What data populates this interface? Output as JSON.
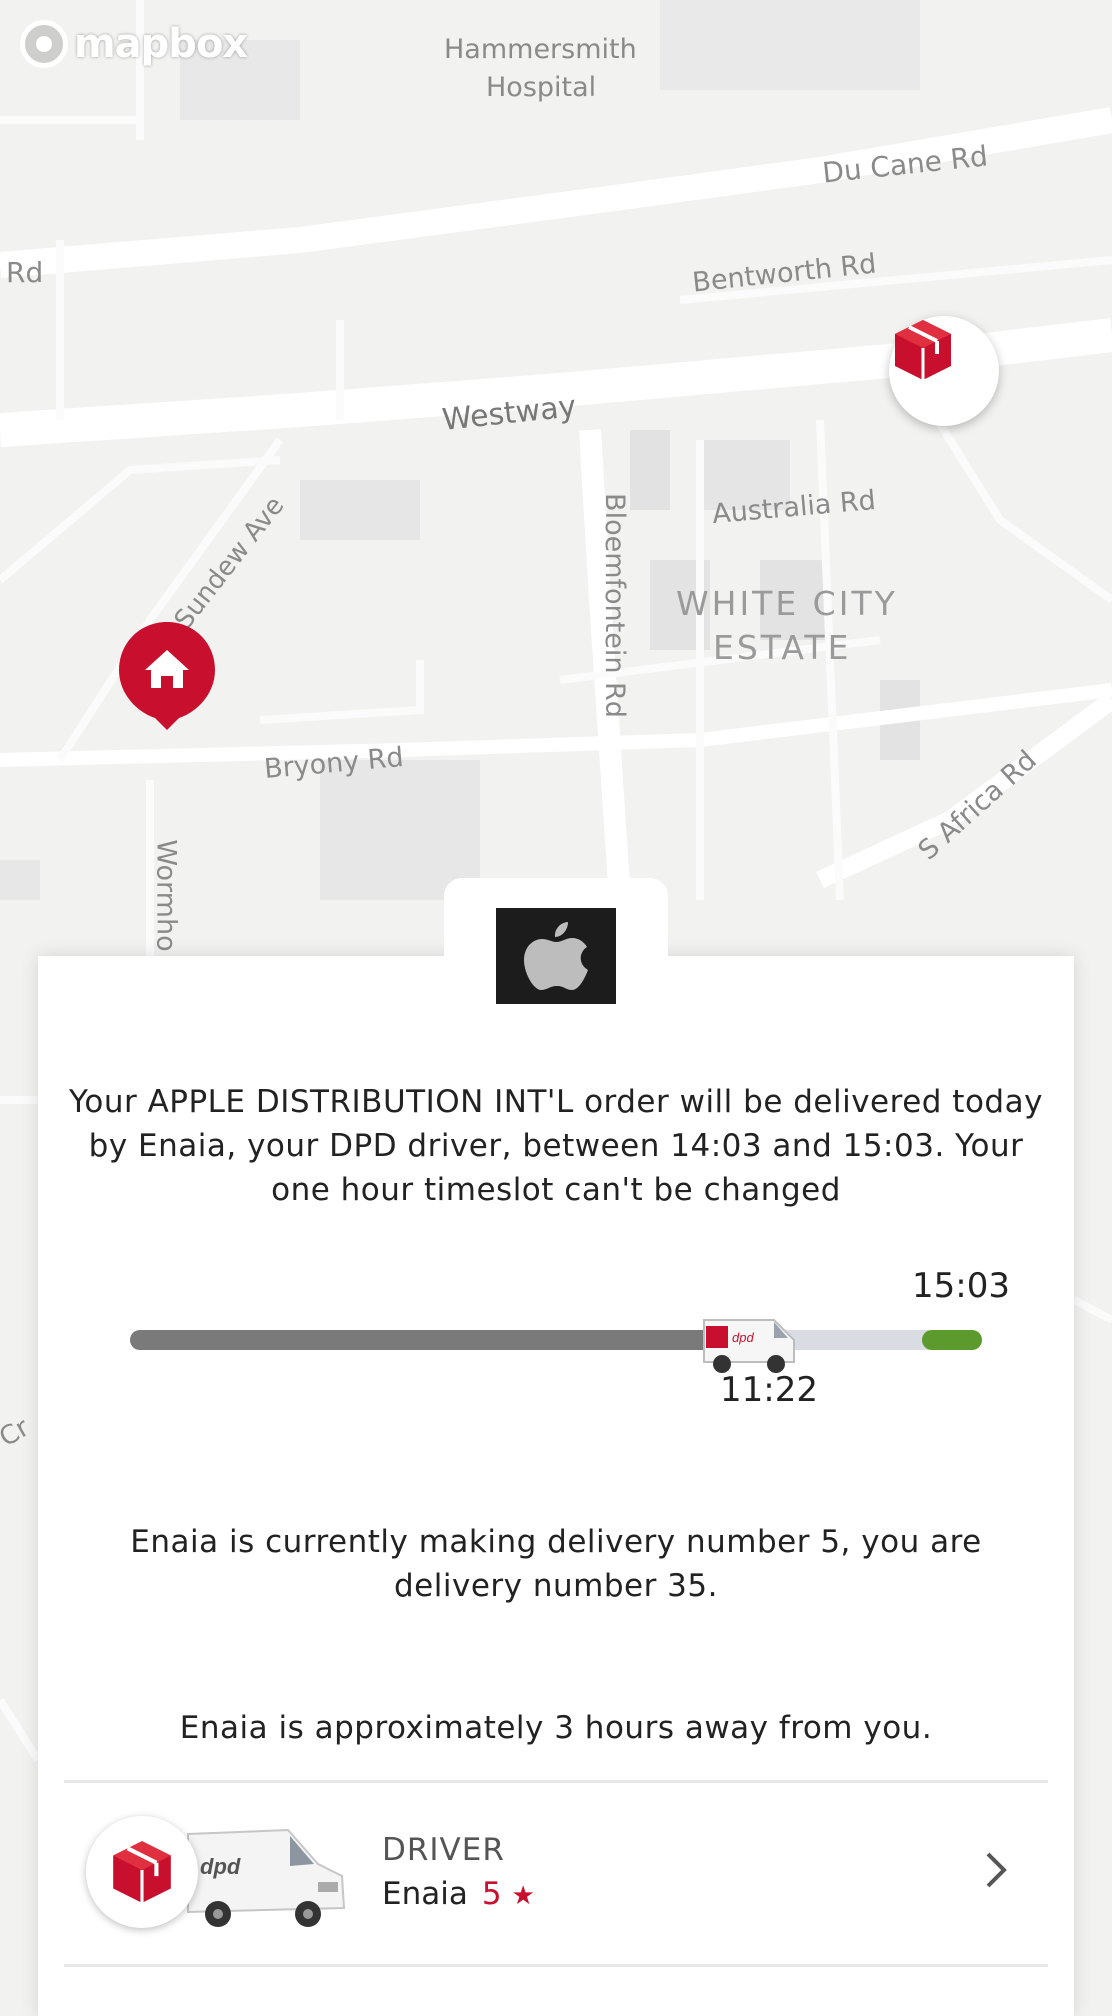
{
  "map": {
    "attribution": "mapbox",
    "labels": {
      "hospital_line1": "Hammersmith",
      "hospital_line2": "Hospital",
      "du_cane": "Du Cane Rd",
      "rd_left": "Rd",
      "bentworth": "Bentworth Rd",
      "westway": "Westway",
      "australia": "Australia Rd",
      "estate_line1": "WHITE CITY",
      "estate_line2": "ESTATE",
      "bloemfontein": "Bloemfontein Rd",
      "sundew": "Sundew Ave",
      "bryony": "Bryony Rd",
      "s_africa": "S Africa Rd",
      "wormholt": "Wormho",
      "cr": "Cr"
    },
    "depot_icon": "dpd-parcel-icon",
    "home_icon": "home-icon"
  },
  "sender_logo": "apple-logo-icon",
  "delivery": {
    "message": "Your APPLE DISTRIBUTION INT'L order will be delivered today by Enaia, your DPD driver, between 14:03 and 15:03. Your one hour timeslot can't be changed",
    "progress": {
      "current_time": "11:22",
      "window_end_time": "15:03",
      "progress_fraction": 0.74,
      "window_start_fraction": 0.93,
      "colors": {
        "done": "#7a7a7a",
        "remaining": "#d9dde3",
        "window": "#5c9a2e"
      }
    },
    "stop_status": "Enaia is currently making delivery number 5, you are delivery number 35.",
    "eta_status": "Enaia is approximately 3 hours away from you."
  },
  "driver": {
    "label": "DRIVER",
    "name": "Enaia",
    "rating": "5",
    "rating_icon": "star-icon"
  },
  "colors": {
    "brand_red": "#c8102e"
  }
}
